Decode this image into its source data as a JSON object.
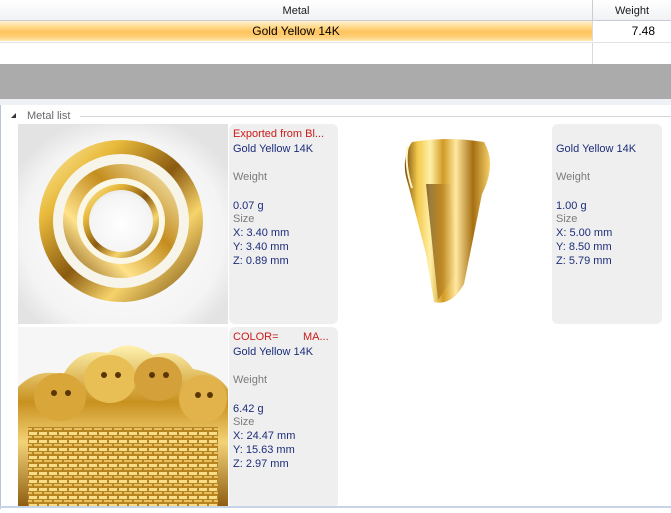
{
  "grid": {
    "columns": {
      "metal": "Metal",
      "weight": "Weight"
    },
    "rows": [
      {
        "metal": "Gold Yellow 14K",
        "weight": "7.48"
      }
    ]
  },
  "metal_list": {
    "group_label": "Metal list",
    "items": [
      {
        "header": "Exported from Bl...",
        "metal": "Gold Yellow 14K",
        "weight_label": "Weight",
        "weight": "0.07 g",
        "size_label": "Size",
        "x": "X: 3.40 mm",
        "y": "Y: 3.40 mm",
        "z": "Z: 0.89 mm",
        "image_icon": "gold-ring-washer-icon"
      },
      {
        "header": "",
        "metal": "Gold Yellow 14K",
        "weight_label": "Weight",
        "weight": "1.00 g",
        "size_label": "Size",
        "x": "X: 5.00 mm",
        "y": "Y: 8.50 mm",
        "z": "Z: 5.79 mm",
        "image_icon": "gold-bail-icon"
      },
      {
        "header_left": "COLOR=",
        "header_right": "MA...",
        "metal": "Gold Yellow 14K",
        "weight_label": "Weight",
        "weight": "6.42 g",
        "size_label": "Size",
        "x": "X: 24.47 mm",
        "y": "Y: 15.63 mm",
        "z": "Z: 2.97 mm",
        "image_icon": "gold-dog-basket-icon"
      }
    ]
  },
  "colors": {
    "selected_row": "#ffc45c",
    "header_text_red": "#cc1a1a",
    "value_text_blue": "#1c2d7a",
    "label_gray": "#7b7b7b",
    "gray_band": "#ababab",
    "gold": "#d6a42a"
  }
}
